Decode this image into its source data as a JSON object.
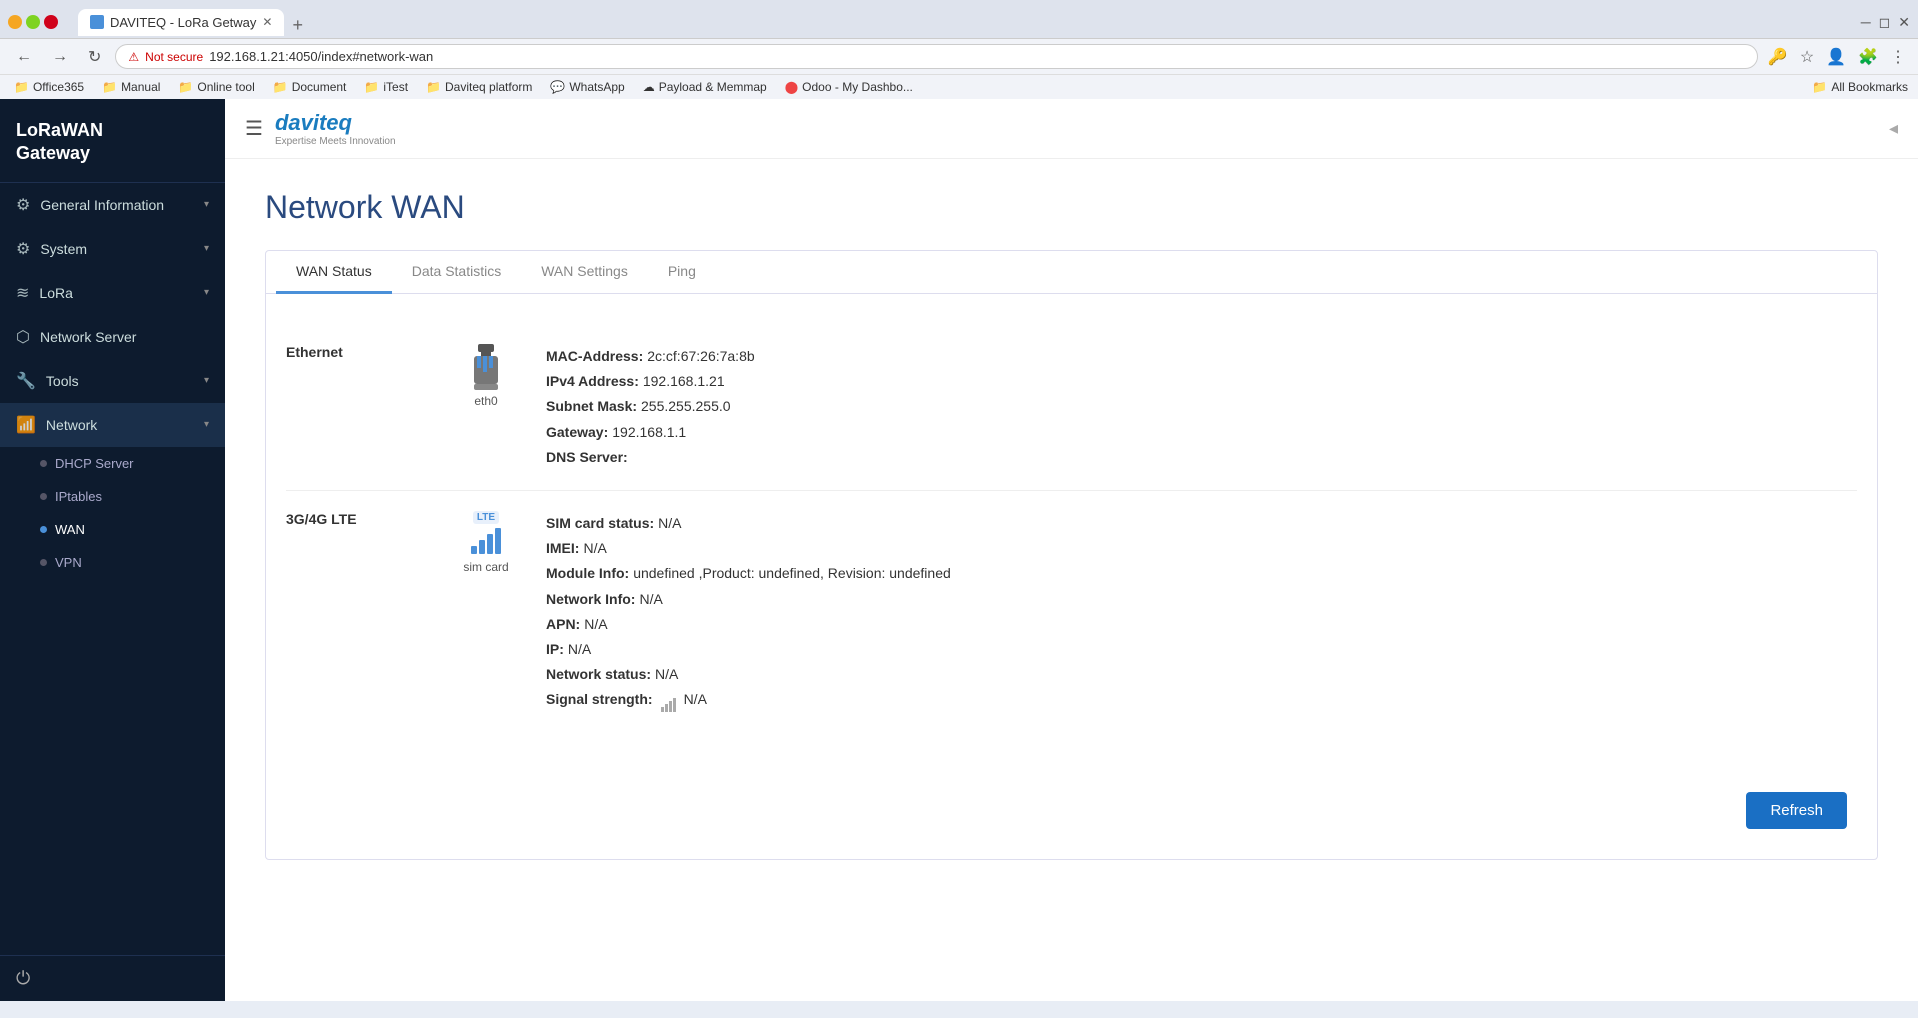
{
  "browser": {
    "tab_title": "DAVITEQ - LoRa Getway",
    "tab_icon": "D",
    "url_security": "Not secure",
    "url": "192.168.1.21:4050/index#network-wan",
    "new_tab_label": "+",
    "window_controls": [
      "minimize",
      "maximize",
      "close"
    ]
  },
  "bookmarks": [
    {
      "label": "Office365",
      "icon": "📁"
    },
    {
      "label": "Manual",
      "icon": "📁"
    },
    {
      "label": "Online tool",
      "icon": "📁"
    },
    {
      "label": "Document",
      "icon": "📁"
    },
    {
      "label": "iTest",
      "icon": "📁"
    },
    {
      "label": "Daviteq platform",
      "icon": "📁"
    },
    {
      "label": "WhatsApp",
      "icon": "💬"
    },
    {
      "label": "Payload & Memmap",
      "icon": "☁"
    },
    {
      "label": "Odoo - My Dashbo...",
      "icon": "⬤"
    },
    {
      "label": "All Bookmarks",
      "icon": "📁"
    }
  ],
  "sidebar": {
    "title": "LoRaWAN\nGateway",
    "items": [
      {
        "id": "general-information",
        "icon": "⚙",
        "label": "General Information",
        "has_children": true,
        "expanded": false
      },
      {
        "id": "system",
        "icon": "⚙",
        "label": "System",
        "has_children": true,
        "expanded": false
      },
      {
        "id": "lora",
        "icon": "≋",
        "label": "LoRa",
        "has_children": true,
        "expanded": false
      },
      {
        "id": "network-server",
        "icon": "⬡",
        "label": "Network Server",
        "has_children": false,
        "expanded": false
      },
      {
        "id": "tools",
        "icon": "🔧",
        "label": "Tools",
        "has_children": true,
        "expanded": false
      },
      {
        "id": "network",
        "icon": "📶",
        "label": "Network",
        "has_children": true,
        "expanded": true
      }
    ],
    "network_subitems": [
      {
        "id": "dhcp-server",
        "label": "DHCP Server",
        "active": false
      },
      {
        "id": "iptables",
        "label": "IPtables",
        "active": false
      },
      {
        "id": "wan",
        "label": "WAN",
        "active": true
      },
      {
        "id": "vpn",
        "label": "VPN",
        "active": false
      }
    ]
  },
  "topbar": {
    "logo_text": "daviteq",
    "logo_sub": "Expertise Meets Innovation"
  },
  "page": {
    "title": "Network WAN",
    "tabs": [
      {
        "id": "wan-status",
        "label": "WAN Status",
        "active": true
      },
      {
        "id": "data-statistics",
        "label": "Data Statistics",
        "active": false
      },
      {
        "id": "wan-settings",
        "label": "WAN Settings",
        "active": false
      },
      {
        "id": "ping",
        "label": "Ping",
        "active": false
      }
    ]
  },
  "ethernet": {
    "section_label": "Ethernet",
    "icon_name": "eth0",
    "mac_label": "MAC-Address:",
    "mac_value": "2c:cf:67:26:7a:8b",
    "ipv4_label": "IPv4 Address:",
    "ipv4_value": "192.168.1.21",
    "subnet_label": "Subnet Mask:",
    "subnet_value": "255.255.255.0",
    "gateway_label": "Gateway:",
    "gateway_value": "192.168.1.1",
    "dns_label": "DNS Server:",
    "dns_value": ""
  },
  "lte": {
    "section_label": "3G/4G LTE",
    "icon_name": "sim card",
    "sim_label": "SIM card status:",
    "sim_value": "N/A",
    "imei_label": "IMEI:",
    "imei_value": "N/A",
    "module_label": "Module Info:",
    "module_value": "undefined ,Product: undefined, Revision: undefined",
    "network_info_label": "Network Info:",
    "network_info_value": "N/A",
    "apn_label": "APN:",
    "apn_value": "N/A",
    "ip_label": "IP:",
    "ip_value": "N/A",
    "network_status_label": "Network status:",
    "network_status_value": "N/A",
    "signal_label": "Signal strength:",
    "signal_value": "N/A"
  },
  "buttons": {
    "refresh": "Refresh"
  }
}
